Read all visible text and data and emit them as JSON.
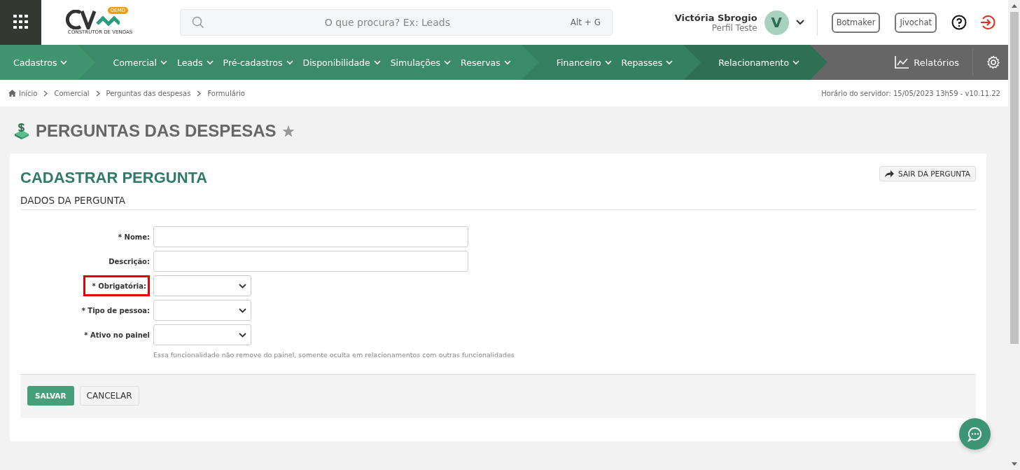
{
  "header": {
    "logo_text": "CONSTRUTOR DE VENDAS",
    "logo_badge": "DEMO",
    "search": {
      "placeholder": "O que procura? Ex: Leads",
      "shortcut": "Alt + G"
    },
    "user": {
      "name": "Victória Sbrogio",
      "profile": "Perfil Teste",
      "initial": "V"
    },
    "buttons": [
      "Botmaker",
      "Jivochat"
    ]
  },
  "nav": {
    "groups": [
      {
        "color": "#40956f",
        "items": [
          "Cadastros"
        ]
      },
      {
        "color": "#3b8a69",
        "items": [
          "Comercial",
          "Leads",
          "Pré-cadastros",
          "Disponibilidade",
          "Simulações",
          "Reservas"
        ]
      },
      {
        "color": "#368062",
        "items": [
          "Financeiro",
          "Repasses"
        ]
      },
      {
        "color": "#2f7055",
        "items": [
          "Relacionamento"
        ]
      }
    ],
    "reports": "Relatórios"
  },
  "breadcrumb": [
    "Início",
    "Comercial",
    "Perguntas das despesas",
    "Formulário"
  ],
  "server_time": "Horário do servidor: 15/05/2023 13h59 - v10.11.22",
  "page_title": "PERGUNTAS DAS DESPESAS",
  "card": {
    "title": "CADASTRAR PERGUNTA",
    "exit_button": "SAIR DA PERGUNTA",
    "section": "DADOS DA PERGUNTA",
    "fields": [
      {
        "kind": "text",
        "highlighted": false,
        "label": "* Nome:"
      },
      {
        "kind": "text",
        "highlighted": false,
        "label": "Descrição:"
      },
      {
        "kind": "select",
        "highlighted": true,
        "label": "* Obrigatória:"
      },
      {
        "kind": "select",
        "highlighted": false,
        "label": "* Tipo de pessoa:"
      },
      {
        "kind": "select",
        "highlighted": false,
        "label": "* Ativo no painel",
        "hint": "Essa funcionalidade não remove do painel, somente oculta em relacionamentos com outras funcionalidades"
      }
    ],
    "save_button": "SALVAR",
    "cancel_button": "CANCELAR"
  }
}
